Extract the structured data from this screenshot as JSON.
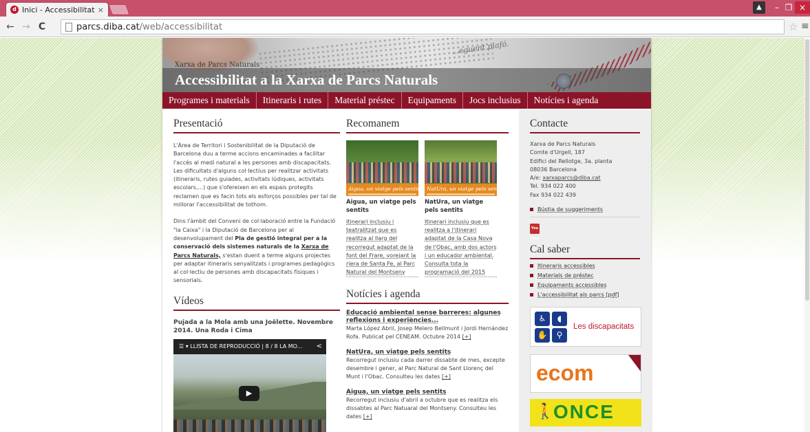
{
  "browser": {
    "tab_title": "Inici - Accessibilitat",
    "tab_close": "×",
    "tab_favicon": "diba-icon",
    "url_domain": "parcs.diba.cat",
    "url_path": "/web/accessibilitat",
    "back_glyph": "←",
    "forward_glyph": "→",
    "reload_glyph": "C",
    "star_glyph": "☆",
    "menu_glyph": "≡",
    "win_user": "▲",
    "win_min": "–",
    "win_max": "❐",
    "win_close": "×"
  },
  "banner": {
    "site_name": "Xarxa de Parcs Naturals",
    "title": "Accessibilitat a la Xarxa de Parcs Naturals",
    "deco_text": "...eguent plafó."
  },
  "nav": [
    "Programes i materials",
    "Itineraris i rutes",
    "Material préstec",
    "Equipaments",
    "Jocs inclusius",
    "Notícies i agenda"
  ],
  "presentacio": {
    "heading": "Presentació",
    "p1": "L'Àrea de Territori i Sostenibilitat de la Diputació de Barcelona duu a terme accions encaminades a facilitar l'accés al medi natural a les persones amb discapacitats. Les dificultats d'alguns col·lectius per realitzar activitats (itineraris, rutes guiades, activitats lúdiques, activitats escolars,...) que s'ofereixen en els espais protegits reclamen que es facin tots els esforços possibles per tal de millorar l'accessibilitat de tothom.",
    "p2_a": "Dins l'àmbit del Conveni de col·laboració entre la Fundació \"la Caixa\" i la Diputació de Barcelona per al desenvolupament del ",
    "p2_bold": "Pla de gestió integral per a la conservació dels sistemes naturals de la",
    "p2_link": "Xarxa de Parcs Naturals,",
    "p2_b": " s'estan duent a terme alguns projectes per adaptar itineraris senyalitzats i programes pedagògics al col·lectiu de persones amb discapacitats físiques i sensorials."
  },
  "videos": {
    "heading": "Vídeos",
    "title": "Pujada a la Mola amb una Joëlette. Novembre 2014. Una Roda i Cima",
    "playlist_label": "☰ ▾ LLISTA DE REPRODUCCIÓ  |  8 / 8    LA MO...",
    "share_glyph": "<",
    "play_glyph": "▶"
  },
  "recomanem": {
    "heading": "Recomanem",
    "items": [
      {
        "image_caption": "Aigua, un viatge pels sentits",
        "title": "Aigua, un viatge pels sentits",
        "desc": "Itinerari inclusiu i teatralitzat que es realitza al llarg del recorregut adaptat de la font del Frare, vorejant la riera de Santa Fe, al Parc Natural del Montseny"
      },
      {
        "image_caption": "NatUra, un viatge pels sentits",
        "title": "NatUra, un viatge pels sentits",
        "desc": "Itinerari inclusiu que es realitza a l'itinerari adaptat de la Casa Nova de l'Obac, amb dos actors i un educador ambiental. Consulta tota la programació del 2015"
      }
    ]
  },
  "noticies": {
    "heading": "Notícies i agenda",
    "items": [
      {
        "title": "Educació ambiental sense barreres: algunes reflexions i experiències...",
        "body": "Marta López Abril, Josep Melero Bellmunt i Jordi Hernández Rofa. Publicat pel CENEAM. Octubre 2014 ",
        "more": "[+]"
      },
      {
        "title": "NatUra, un viatge pels sentits",
        "body": "Recorregut inclusiu cada darrer dissabte de mes, excepte desembre i gener, al Parc Natural de Sant Llorenç del Munt i l'Obac. Consulteu les dates ",
        "more": "[+]"
      },
      {
        "title": "Aigua, un viatge pels sentits",
        "body": "Recorregut inclusiu d'abril a octubre que es realitza els dissabtes al Parc Natuaral del Montseny. Consulteu les dates ",
        "more": "[+]"
      }
    ]
  },
  "contacte": {
    "heading": "Contacte",
    "line1": "Xarxa de Parcs Naturals",
    "line2": "Comte d'Urgell, 187",
    "line3": "Edifici del Rellotge, 3a. planta",
    "line4": "08036 Barcelona",
    "email_prefix": "A/e: ",
    "email": "xarxaparcs@diba.cat",
    "tel": "Tel. 934 022 400",
    "fax": "Fax 934 022 439",
    "suggestions": "Bústia de suggeriments",
    "youtube_label": "You Tube"
  },
  "cal_saber": {
    "heading": "Cal saber",
    "links": [
      "Itineraris accessibles",
      "Materials de préstec",
      "Equipaments accessibles",
      "L'accessibilitat als parcs [pdf]"
    ]
  },
  "partners": {
    "discapacitats": "Les discapacitats",
    "ecom": "ecom",
    "once": "ONCE"
  },
  "colors": {
    "accent": "#8c1429",
    "tabbar": "#c7506b",
    "ecom_orange": "#e8741b",
    "once_yellow": "#f2e21a",
    "once_green": "#1e8f2a"
  }
}
